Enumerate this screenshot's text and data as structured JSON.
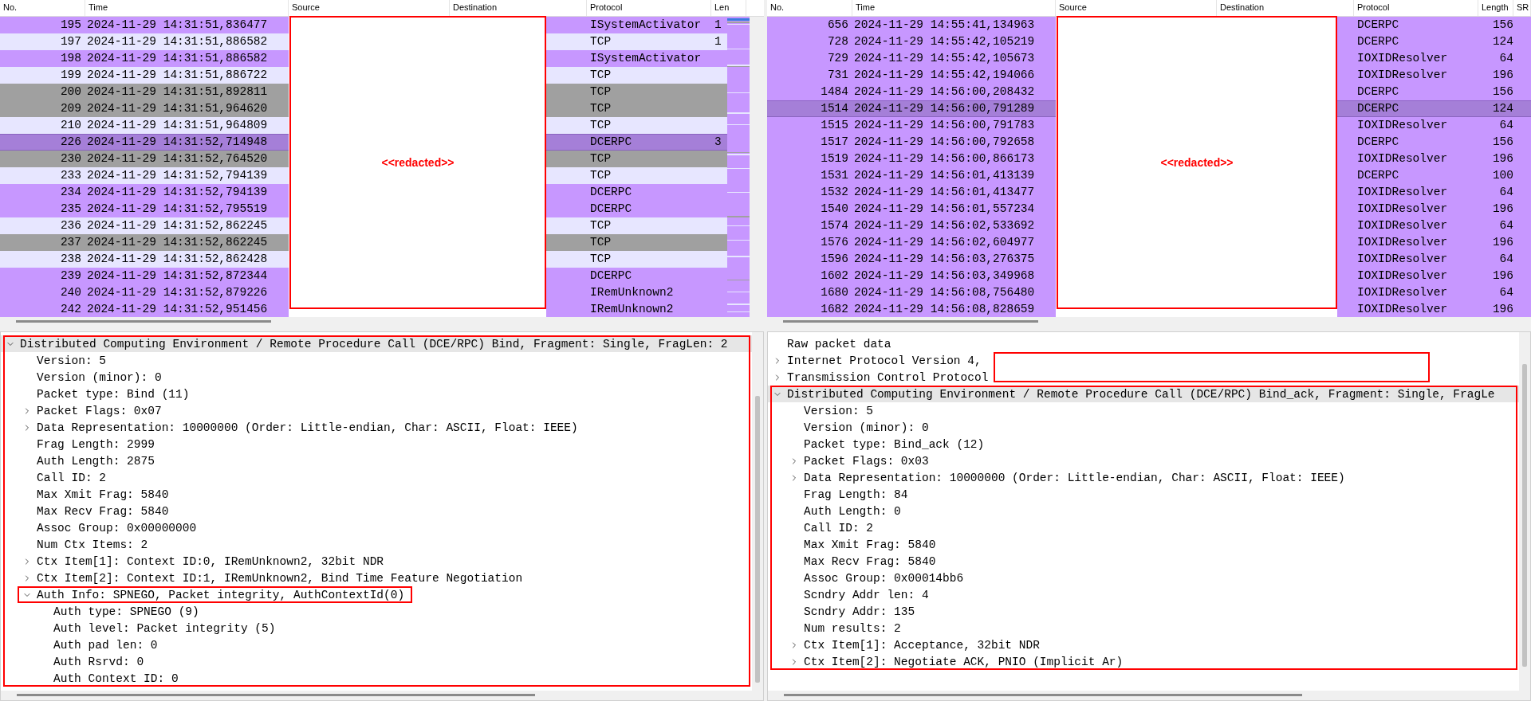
{
  "panes": [
    {
      "packet_list": {
        "columns": [
          "No.",
          "Time",
          "Source",
          "Destination",
          "Protocol",
          "Len"
        ],
        "minimap": true,
        "redaction_label": "<<redacted>>",
        "rows": [
          {
            "no": "195",
            "time": "2024-11-29 14:31:51,836477",
            "protocol": "ISystemActivator",
            "length": "1",
            "color": "#c797ff",
            "selected": false
          },
          {
            "no": "197",
            "time": "2024-11-29 14:31:51,886582",
            "protocol": "TCP",
            "length": "1",
            "color": "#e7e6ff",
            "selected": false
          },
          {
            "no": "198",
            "time": "2024-11-29 14:31:51,886582",
            "protocol": "ISystemActivator",
            "color": "#c797ff",
            "selected": false
          },
          {
            "no": "199",
            "time": "2024-11-29 14:31:51,886722",
            "protocol": "TCP",
            "color": "#e7e6ff",
            "selected": false
          },
          {
            "no": "200",
            "time": "2024-11-29 14:31:51,892811",
            "protocol": "TCP",
            "color": "#a0a0a0",
            "selected": false
          },
          {
            "no": "209",
            "time": "2024-11-29 14:31:51,964620",
            "protocol": "TCP",
            "color": "#a0a0a0",
            "selected": false
          },
          {
            "no": "210",
            "time": "2024-11-29 14:31:51,964809",
            "protocol": "TCP",
            "color": "#e7e6ff",
            "selected": false
          },
          {
            "no": "226",
            "time": "2024-11-29 14:31:52,714948",
            "protocol": "DCERPC",
            "length": "3",
            "color": "#a57fd8",
            "selected": true
          },
          {
            "no": "230",
            "time": "2024-11-29 14:31:52,764520",
            "protocol": "TCP",
            "color": "#a0a0a0",
            "selected": false
          },
          {
            "no": "233",
            "time": "2024-11-29 14:31:52,794139",
            "protocol": "TCP",
            "color": "#e7e6ff",
            "selected": false
          },
          {
            "no": "234",
            "time": "2024-11-29 14:31:52,794139",
            "protocol": "DCERPC",
            "color": "#c797ff",
            "selected": false
          },
          {
            "no": "235",
            "time": "2024-11-29 14:31:52,795519",
            "protocol": "DCERPC",
            "color": "#c797ff",
            "selected": false
          },
          {
            "no": "236",
            "time": "2024-11-29 14:31:52,862245",
            "protocol": "TCP",
            "color": "#e7e6ff",
            "selected": false
          },
          {
            "no": "237",
            "time": "2024-11-29 14:31:52,862245",
            "protocol": "TCP",
            "color": "#a0a0a0",
            "selected": false
          },
          {
            "no": "238",
            "time": "2024-11-29 14:31:52,862428",
            "protocol": "TCP",
            "color": "#e7e6ff",
            "selected": false
          },
          {
            "no": "239",
            "time": "2024-11-29 14:31:52,872344",
            "protocol": "DCERPC",
            "color": "#c797ff",
            "selected": false
          },
          {
            "no": "240",
            "time": "2024-11-29 14:31:52,879226",
            "protocol": "IRemUnknown2",
            "color": "#c797ff",
            "selected": false
          },
          {
            "no": "242",
            "time": "2024-11-29 14:31:52,951456",
            "protocol": "IRemUnknown2",
            "color": "#c797ff",
            "selected": false
          }
        ]
      },
      "details": {
        "tree": [
          {
            "label": "Distributed Computing Environment / Remote Procedure Call (DCE/RPC) Bind, Fragment: Single, FragLen: 2",
            "selected": true,
            "expanded": true,
            "framed": true,
            "children": [
              {
                "label": "Version: 5",
                "selected": false
              },
              {
                "label": "Version (minor): 0",
                "selected": false
              },
              {
                "label": "Packet type: Bind (11)",
                "selected": false
              },
              {
                "label": "Packet Flags: 0x07",
                "selected": false,
                "expanded": false
              },
              {
                "label": "Data Representation: 10000000 (Order: Little-endian, Char: ASCII, Float: IEEE)",
                "selected": false,
                "expanded": false
              },
              {
                "label": "Frag Length: 2999",
                "selected": false
              },
              {
                "label": "Auth Length: 2875",
                "selected": false
              },
              {
                "label": "Call ID: 2",
                "selected": false
              },
              {
                "label": "Max Xmit Frag: 5840",
                "selected": false
              },
              {
                "label": "Max Recv Frag: 5840",
                "selected": false
              },
              {
                "label": "Assoc Group: 0x00000000",
                "selected": false
              },
              {
                "label": "Num Ctx Items: 2",
                "selected": false
              },
              {
                "label": "Ctx Item[1]: Context ID:0, IRemUnknown2, 32bit NDR",
                "selected": false,
                "expanded": false
              },
              {
                "label": "Ctx Item[2]: Context ID:1, IRemUnknown2, Bind Time Feature Negotiation",
                "selected": false,
                "expanded": false
              },
              {
                "label": "Auth Info: SPNEGO, Packet integrity, AuthContextId(0)",
                "selected": false,
                "expanded": true,
                "outlined": true,
                "children": [
                  {
                    "label": "Auth type: SPNEGO (9)",
                    "selected": false
                  },
                  {
                    "label": "Auth level: Packet integrity (5)",
                    "selected": false
                  },
                  {
                    "label": "Auth pad len: 0",
                    "selected": false
                  },
                  {
                    "label": "Auth Rsrvd: 0",
                    "selected": false
                  },
                  {
                    "label": "Auth Context ID: 0",
                    "selected": false
                  }
                ]
              }
            ]
          }
        ]
      }
    },
    {
      "packet_list": {
        "columns": [
          "No.",
          "Time",
          "Source",
          "Destination",
          "Protocol",
          "Length",
          "SR"
        ],
        "redaction_label": "<<redacted>>",
        "rows": [
          {
            "no": "656",
            "time": "2024-11-29 14:55:41,134963",
            "protocol": "DCERPC",
            "length": "156",
            "color": "#c797ff",
            "selected": false
          },
          {
            "no": "728",
            "time": "2024-11-29 14:55:42,105219",
            "protocol": "DCERPC",
            "length": "124",
            "color": "#c797ff",
            "selected": false
          },
          {
            "no": "729",
            "time": "2024-11-29 14:55:42,105673",
            "protocol": "IOXIDResolver",
            "length": "64",
            "color": "#c797ff",
            "selected": false
          },
          {
            "no": "731",
            "time": "2024-11-29 14:55:42,194066",
            "protocol": "IOXIDResolver",
            "length": "196",
            "color": "#c797ff",
            "selected": false
          },
          {
            "no": "1484",
            "time": "2024-11-29 14:56:00,208432",
            "protocol": "DCERPC",
            "length": "156",
            "color": "#c797ff",
            "selected": false
          },
          {
            "no": "1514",
            "time": "2024-11-29 14:56:00,791289",
            "protocol": "DCERPC",
            "length": "124",
            "color": "#a57fd8",
            "selected": true
          },
          {
            "no": "1515",
            "time": "2024-11-29 14:56:00,791783",
            "protocol": "IOXIDResolver",
            "length": "64",
            "color": "#c797ff",
            "selected": false
          },
          {
            "no": "1517",
            "time": "2024-11-29 14:56:00,792658",
            "protocol": "DCERPC",
            "length": "156",
            "color": "#c797ff",
            "selected": false
          },
          {
            "no": "1519",
            "time": "2024-11-29 14:56:00,866173",
            "protocol": "IOXIDResolver",
            "length": "196",
            "color": "#c797ff",
            "selected": false
          },
          {
            "no": "1531",
            "time": "2024-11-29 14:56:01,413139",
            "protocol": "DCERPC",
            "length": "100",
            "color": "#c797ff",
            "selected": false
          },
          {
            "no": "1532",
            "time": "2024-11-29 14:56:01,413477",
            "protocol": "IOXIDResolver",
            "length": "64",
            "color": "#c797ff",
            "selected": false
          },
          {
            "no": "1540",
            "time": "2024-11-29 14:56:01,557234",
            "protocol": "IOXIDResolver",
            "length": "196",
            "color": "#c797ff",
            "selected": false
          },
          {
            "no": "1574",
            "time": "2024-11-29 14:56:02,533692",
            "protocol": "IOXIDResolver",
            "length": "64",
            "color": "#c797ff",
            "selected": false
          },
          {
            "no": "1576",
            "time": "2024-11-29 14:56:02,604977",
            "protocol": "IOXIDResolver",
            "length": "196",
            "color": "#c797ff",
            "selected": false
          },
          {
            "no": "1596",
            "time": "2024-11-29 14:56:03,276375",
            "protocol": "IOXIDResolver",
            "length": "64",
            "color": "#c797ff",
            "selected": false
          },
          {
            "no": "1602",
            "time": "2024-11-29 14:56:03,349968",
            "protocol": "IOXIDResolver",
            "length": "196",
            "color": "#c797ff",
            "selected": false
          },
          {
            "no": "1680",
            "time": "2024-11-29 14:56:08,756480",
            "protocol": "IOXIDResolver",
            "length": "64",
            "color": "#c797ff",
            "selected": false
          },
          {
            "no": "1682",
            "time": "2024-11-29 14:56:08,828659",
            "protocol": "IOXIDResolver",
            "length": "196",
            "color": "#c797ff",
            "selected": false
          }
        ]
      },
      "details": {
        "redaction_overlay": true,
        "tree": [
          {
            "label": "Raw packet data",
            "selected": false
          },
          {
            "label": "Internet Protocol Version 4,",
            "selected": false,
            "expanded": false
          },
          {
            "label": "Transmission Control Protocol",
            "selected": false,
            "expanded": false
          },
          {
            "label": "Distributed Computing Environment / Remote Procedure Call (DCE/RPC) Bind_ack, Fragment: Single, FragLe",
            "selected": true,
            "expanded": true,
            "framed": true,
            "children": [
              {
                "label": "Version: 5",
                "selected": false
              },
              {
                "label": "Version (minor): 0",
                "selected": false
              },
              {
                "label": "Packet type: Bind_ack (12)",
                "selected": false
              },
              {
                "label": "Packet Flags: 0x03",
                "selected": false,
                "expanded": false
              },
              {
                "label": "Data Representation: 10000000 (Order: Little-endian, Char: ASCII, Float: IEEE)",
                "selected": false,
                "expanded": false
              },
              {
                "label": "Frag Length: 84",
                "selected": false
              },
              {
                "label": "Auth Length: 0",
                "selected": false
              },
              {
                "label": "Call ID: 2",
                "selected": false
              },
              {
                "label": "Max Xmit Frag: 5840",
                "selected": false
              },
              {
                "label": "Max Recv Frag: 5840",
                "selected": false
              },
              {
                "label": "Assoc Group: 0x00014bb6",
                "selected": false
              },
              {
                "label": "Scndry Addr len: 4",
                "selected": false
              },
              {
                "label": "Scndry Addr: 135",
                "selected": false
              },
              {
                "label": "Num results: 2",
                "selected": false
              },
              {
                "label": "Ctx Item[1]: Acceptance, 32bit NDR",
                "selected": false,
                "expanded": false
              },
              {
                "label": "Ctx Item[2]: Negotiate ACK, PNIO (Implicit Ar)",
                "selected": false,
                "expanded": false
              }
            ]
          }
        ]
      }
    }
  ]
}
